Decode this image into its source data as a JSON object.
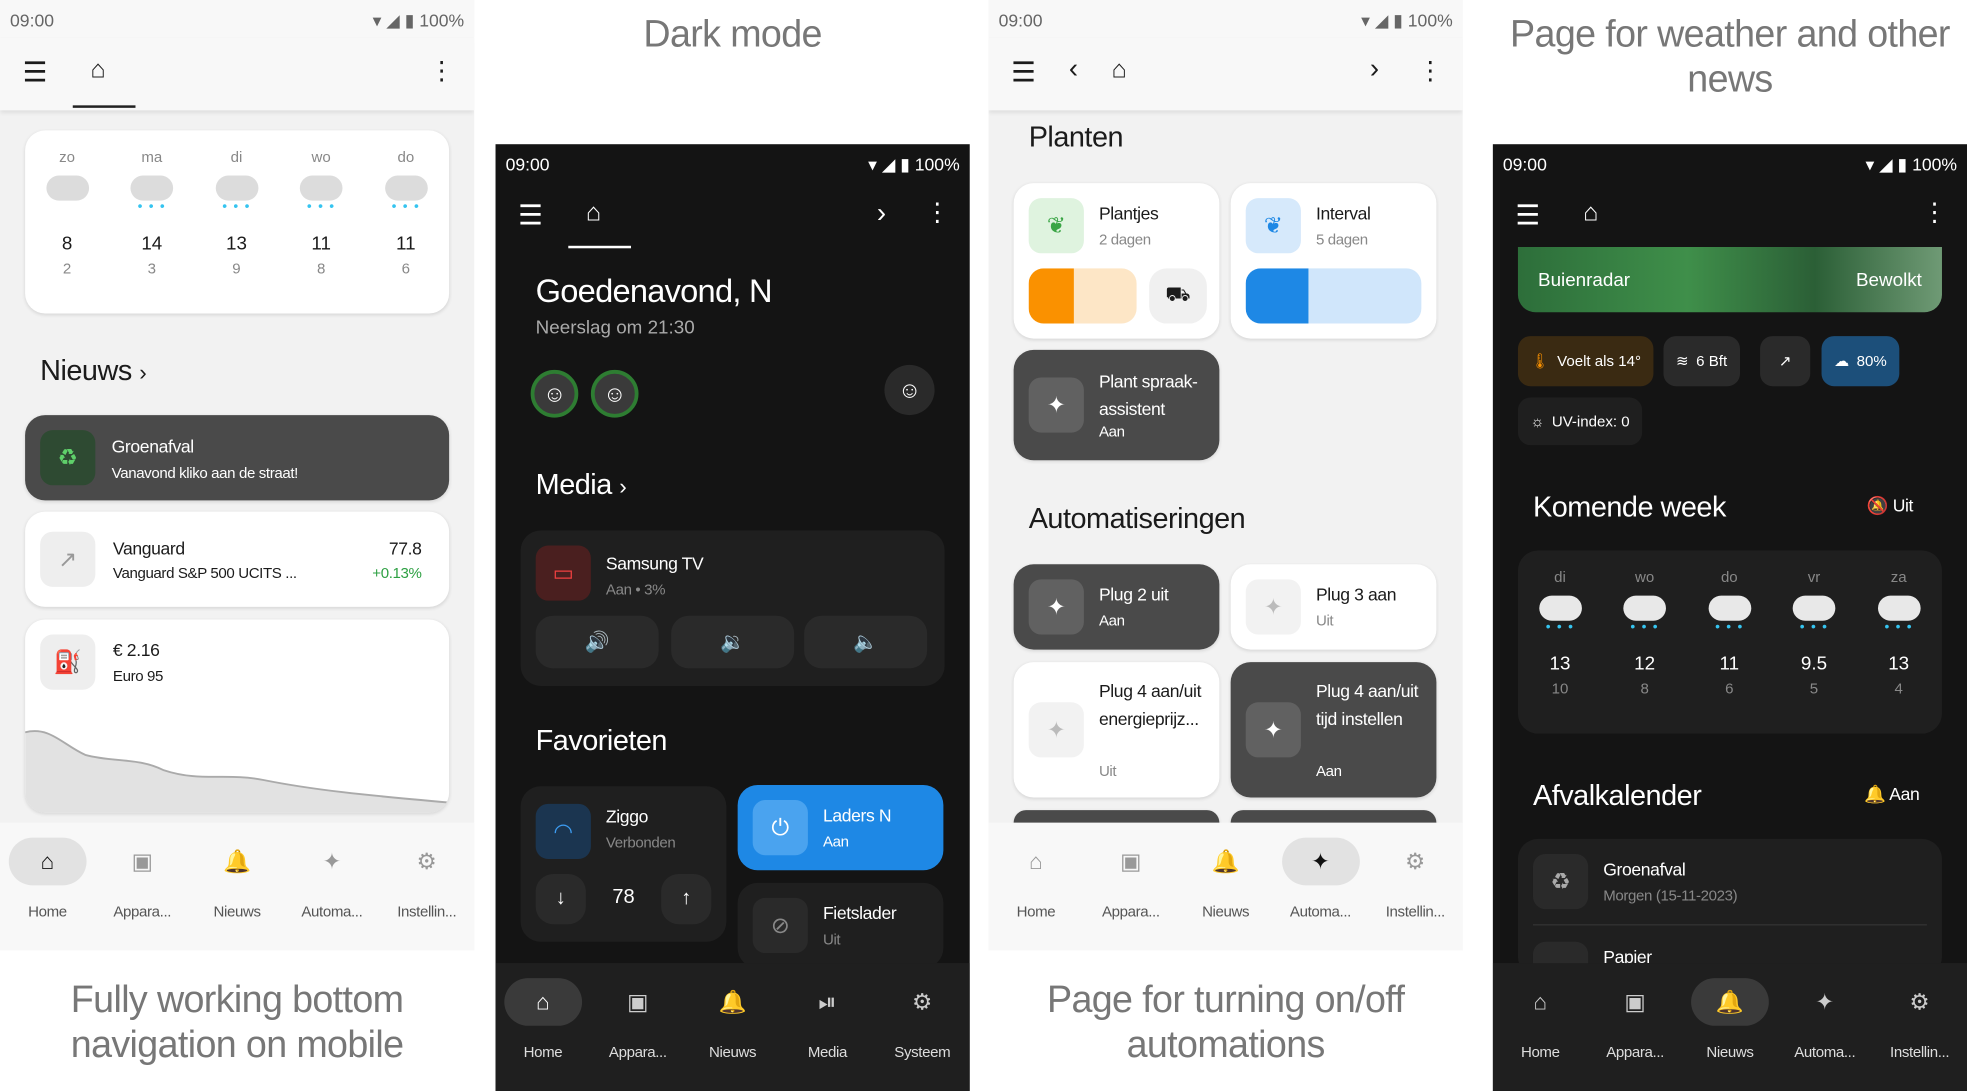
{
  "captions": {
    "p1": "Fully working bottom navigation on mobile",
    "p2": "Dark mode",
    "p3": "Page for turning on/off automations",
    "p4": "Page for weather and other news"
  },
  "status": {
    "time": "09:00",
    "battery": "100%"
  },
  "p1": {
    "forecast": [
      {
        "day": "zo",
        "hi": "8",
        "lo": "2"
      },
      {
        "day": "ma",
        "hi": "14",
        "lo": "3"
      },
      {
        "day": "di",
        "hi": "13",
        "lo": "9"
      },
      {
        "day": "wo",
        "hi": "11",
        "lo": "8"
      },
      {
        "day": "do",
        "hi": "11",
        "lo": "6"
      }
    ],
    "news_title": "Nieuws",
    "news_item": {
      "title": "Groenafval",
      "sub": "Vanavond kliko aan de straat!"
    },
    "stock": {
      "title": "Vanguard",
      "sub": "Vanguard S&P 500 UCITS ...",
      "value": "77.8",
      "change": "+0.13%"
    },
    "fuel": {
      "price": "€ 2.16",
      "name": "Euro 95"
    },
    "nav": [
      "Home",
      "Appara...",
      "Nieuws",
      "Automa...",
      "Instellin..."
    ]
  },
  "p2": {
    "greeting": "Goedenavond, N",
    "sub": "Neerslag om 21:30",
    "media_title": "Media",
    "tv": {
      "title": "Samsung TV",
      "sub": "Aan • 3%"
    },
    "fav_title": "Favorieten",
    "wifi": {
      "title": "Ziggo",
      "sub": "Verbonden",
      "value": "78"
    },
    "laders": {
      "title": "Laders N",
      "sub": "Aan"
    },
    "fiets": {
      "title": "Fietslader",
      "sub": "Uit"
    },
    "nav": [
      "Home",
      "Appara...",
      "Nieuws",
      "Media",
      "Systeem"
    ]
  },
  "p3": {
    "title": "Planten",
    "plant1": {
      "title": "Plantjes",
      "sub": "2 dagen"
    },
    "plant2": {
      "title": "Interval",
      "sub": "5 dagen"
    },
    "assist": {
      "title": "Plant spraak-assistent",
      "sub": "Aan"
    },
    "auto_title": "Automatiseringen",
    "a1": {
      "title": "Plug 2 uit",
      "sub": "Aan"
    },
    "a2": {
      "title": "Plug 3 aan",
      "sub": "Uit"
    },
    "a3": {
      "title": "Plug 4 aan/uit energieprijz...",
      "sub": "Uit"
    },
    "a4": {
      "title": "Plug 4 aan/uit tijd instellen",
      "sub": "Aan"
    },
    "nav": [
      "Home",
      "Appara...",
      "Nieuws",
      "Automa...",
      "Instellin..."
    ]
  },
  "p4": {
    "radar_left": "Buienradar",
    "radar_right": "Bewolkt",
    "chips": {
      "feels": "Voelt als 14°",
      "wind": "6 Bft",
      "rain": "80%",
      "uv": "UV-index: 0"
    },
    "week_title": "Komende week",
    "week_toggle": "Uit",
    "forecast": [
      {
        "day": "di",
        "hi": "13",
        "lo": "10"
      },
      {
        "day": "wo",
        "hi": "12",
        "lo": "8"
      },
      {
        "day": "do",
        "hi": "11",
        "lo": "6"
      },
      {
        "day": "vr",
        "hi": "9.5",
        "lo": "5"
      },
      {
        "day": "za",
        "hi": "13",
        "lo": "4"
      }
    ],
    "waste_title": "Afvalkalender",
    "waste_toggle": "Aan",
    "waste1": {
      "title": "Groenafval",
      "sub": "Morgen (15-11-2023)"
    },
    "waste2": {
      "title": "Papier"
    },
    "nav": [
      "Home",
      "Appara...",
      "Nieuws",
      "Automa...",
      "Instellin..."
    ]
  },
  "colors": {
    "accent_orange": "#fa9100",
    "accent_blue": "#1e88e5",
    "rain_blue": "#35c4f0",
    "green": "#4caf50"
  }
}
